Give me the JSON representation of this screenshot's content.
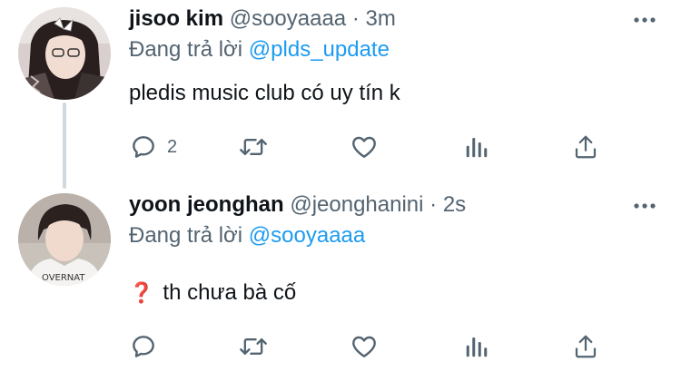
{
  "tweets": [
    {
      "name": "jisoo kim",
      "handle": "@sooyaaaa",
      "separator": "·",
      "time": "3m",
      "reply_prefix": "Đang trả lời",
      "reply_to": "@plds_update",
      "text": "pledis music club có uy tín k",
      "reply_count": "2"
    },
    {
      "name": "yoon jeonghan",
      "handle": "@jeonghanini",
      "separator": "·",
      "time": "2s",
      "reply_prefix": "Đang trả lời",
      "reply_to": "@sooyaaaa",
      "emoji": "❓",
      "text": "th chưa bà cố",
      "reply_count": ""
    }
  ],
  "icons": [
    "reply-icon",
    "retweet-icon",
    "like-icon",
    "stats-icon",
    "share-icon",
    "more-icon"
  ],
  "colors": {
    "link": "#1d9bf0",
    "secondary": "#536471",
    "primary_text": "#0f1419",
    "thread_line": "#cfd9de"
  }
}
